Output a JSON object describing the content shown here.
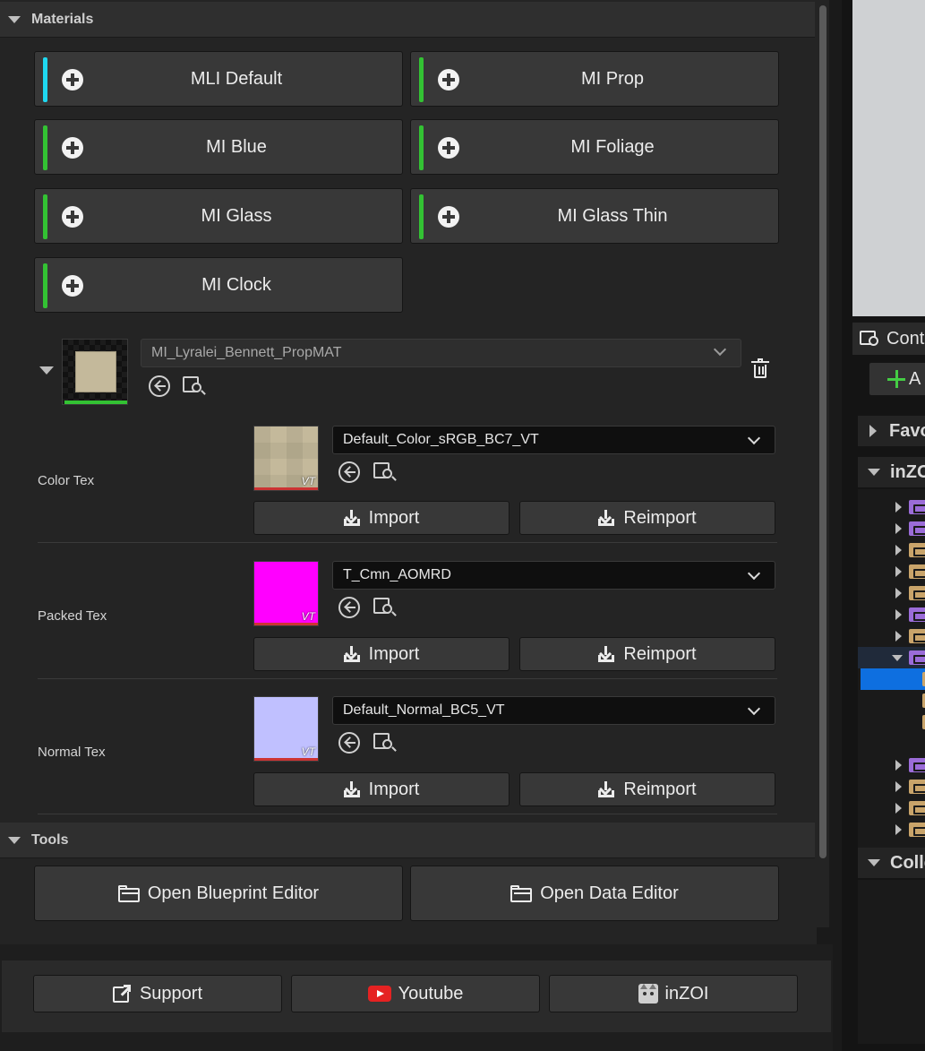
{
  "sections": {
    "materials": "Materials",
    "tools": "Tools"
  },
  "material_buttons": [
    {
      "label": "MLI Default",
      "accent": "#1fd8f0"
    },
    {
      "label": "MI Prop",
      "accent": "#33c233"
    },
    {
      "label": "MI Blue",
      "accent": "#33c233"
    },
    {
      "label": "MI Foliage",
      "accent": "#33c233"
    },
    {
      "label": "MI Glass",
      "accent": "#33c233"
    },
    {
      "label": "MI Glass Thin",
      "accent": "#33c233"
    },
    {
      "label": "MI Clock",
      "accent": "#33c233"
    }
  ],
  "material_instance": {
    "selected": "MI_Lyralei_Bennett_PropMAT"
  },
  "textures": [
    {
      "label": "Color Tex",
      "value": "Default_Color_sRGB_BC7_VT",
      "swatch": "#c4b99b",
      "badge": "VT",
      "import": "Import",
      "reimport": "Reimport"
    },
    {
      "label": "Packed Tex",
      "value": "T_Cmn_AOMRD",
      "swatch": "#ff00ff",
      "badge": "VT",
      "import": "Import",
      "reimport": "Reimport"
    },
    {
      "label": "Normal Tex",
      "value": "Default_Normal_BC5_VT",
      "swatch": "#c0c0ff",
      "badge": "VT",
      "import": "Import",
      "reimport": "Reimport"
    }
  ],
  "tools": {
    "open_blueprint": "Open Blueprint Editor",
    "open_data": "Open Data Editor"
  },
  "footer": {
    "support": "Support",
    "youtube": "Youtube",
    "inzoi": "inZOI"
  },
  "content_browser": {
    "tab": "Cont",
    "add": "A",
    "favorites": "Favo",
    "root": "inZO",
    "collections": "Colle"
  },
  "colors": {
    "accent_green": "#33c233",
    "accent_cyan": "#1fd8f0",
    "selection_blue": "#0e6fe0",
    "folder_purple": "#9b6cd8",
    "folder_tan": "#c9a46a"
  }
}
